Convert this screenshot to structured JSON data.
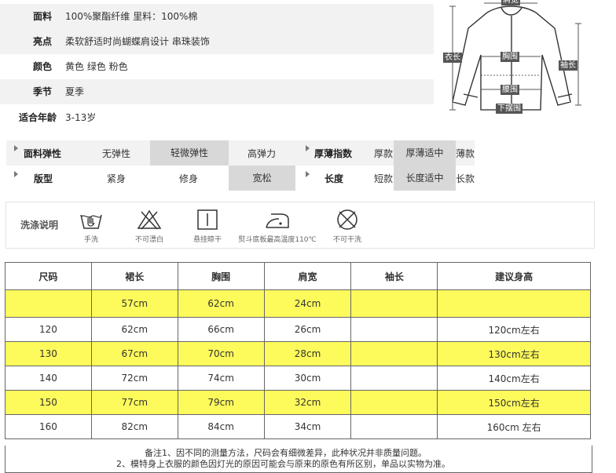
{
  "info": [
    {
      "label": "面料",
      "value": "100%聚酯纤维 里料：100%棉"
    },
    {
      "label": "亮点",
      "value": "柔软舒适时尚蝴蝶肩设计 串珠装饰"
    },
    {
      "label": "颜色",
      "value": "黄色 绿色 粉色"
    },
    {
      "label": "季节",
      "value": "夏季"
    },
    {
      "label": "适合年龄",
      "value": "3-13岁"
    }
  ],
  "garment_labels": {
    "top": "肩宽",
    "left": "衣长",
    "chest": "胸围",
    "right": "袖长",
    "waist": "腰围",
    "hem": "下摆围"
  },
  "attributes": {
    "elasticity": {
      "label": "面料弹性",
      "options": [
        "无弹性",
        "轻微弹性",
        "高弹力"
      ],
      "selected": "轻微弹性"
    },
    "thickness": {
      "label": "厚薄指数",
      "options": [
        "厚款",
        "厚薄适中",
        "薄款"
      ],
      "selected": "厚薄适中"
    },
    "fit": {
      "label": "版型",
      "options": [
        "紧身",
        "修身",
        "宽松"
      ],
      "selected": "宽松"
    },
    "length": {
      "label": "长度",
      "options": [
        "短款",
        "长度适中",
        "长款"
      ],
      "selected": "长度适中"
    }
  },
  "wash": {
    "title": "洗涤说明",
    "items": [
      {
        "icon": "hand-wash-icon",
        "caption": "手洗"
      },
      {
        "icon": "no-bleach-icon",
        "caption": "不可漂白"
      },
      {
        "icon": "hang-dry-icon",
        "caption": "悬挂晾干"
      },
      {
        "icon": "iron-icon",
        "caption": "熨斗底板最高温度110℃"
      },
      {
        "icon": "no-dry-clean-icon",
        "caption": "不可干洗"
      }
    ]
  },
  "size_table": {
    "headers": [
      "尺码",
      "裙长",
      "胸围",
      "肩宽",
      "袖长",
      "建议身高"
    ],
    "rows": [
      [
        "",
        "57cm",
        "62cm",
        "24cm",
        "",
        ""
      ],
      [
        "120",
        "62cm",
        "66cm",
        "26cm",
        "",
        "120cm左右"
      ],
      [
        "130",
        "67cm",
        "70cm",
        "28cm",
        "",
        "130cm左右"
      ],
      [
        "140",
        "72cm",
        "74cm",
        "30cm",
        "",
        "140cm左右"
      ],
      [
        "150",
        "77cm",
        "79cm",
        "32cm",
        "",
        "150cm左右"
      ],
      [
        "160",
        "82cm",
        "84cm",
        "34cm",
        "",
        "160cm 左右"
      ]
    ],
    "notes": [
      "备注1、因不同的测量方法，尺码会有细微差异，此种状况并非质量问题。",
      "2、模特身上衣服的颜色因灯光的原因可能会与原来的原色有所区别，单品以实物为准。"
    ]
  },
  "colors": {
    "highlight": "#fdfa5b",
    "selected": "#d8d8d8",
    "shade": "#f2f2f2",
    "label_bg": "#555555"
  }
}
